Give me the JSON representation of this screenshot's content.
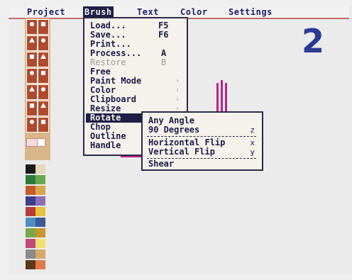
{
  "menubar": {
    "titles": [
      "Project",
      "Brush",
      "Text",
      "Color",
      "Settings"
    ],
    "active": "Brush"
  },
  "brush_menu": {
    "items": [
      {
        "label": "Load...",
        "key": "F5"
      },
      {
        "label": "Save...",
        "key": "F6"
      },
      {
        "label": "Print...",
        "key": ""
      },
      {
        "label": "Process...",
        "key": "A"
      },
      {
        "label": "Restore",
        "key": "B",
        "disabled": true
      },
      {
        "label": "Free",
        "key": ""
      },
      {
        "label": "Paint Mode",
        "key": "",
        "submenu": true
      },
      {
        "label": "Color",
        "key": "",
        "submenu": true
      },
      {
        "label": "Clipboard",
        "key": "",
        "submenu": true
      },
      {
        "label": "Resize",
        "key": "",
        "submenu": true
      },
      {
        "label": "Rotate",
        "key": "",
        "submenu": true,
        "highlighted": true
      },
      {
        "label": "Chop",
        "key": ""
      },
      {
        "label": "Outline",
        "key": ""
      },
      {
        "label": "Handle",
        "key": ""
      }
    ],
    "submenu_arrow": "›"
  },
  "rotate_submenu": {
    "items": [
      {
        "label": "Any Angle",
        "key": ""
      },
      {
        "label": "90 Degrees",
        "key": "z"
      },
      {
        "label": "Horizontal Flip",
        "key": "x"
      },
      {
        "label": "Vertical Flip",
        "key": "y"
      },
      {
        "label": "Shear",
        "key": ""
      }
    ]
  },
  "corner_number": "2",
  "colors": {
    "menu_text": "#1c1c4a",
    "highlight": "#1e1e46",
    "canvas_lines": "#b82486",
    "number": "#2a3a94",
    "toolbox": "#b04a2f"
  },
  "tool_icons": [
    "pointer-icon",
    "brush-icon",
    "circle-icon",
    "rectangle-icon",
    "line-icon",
    "fill-icon",
    "airbrush-icon",
    "curve-icon",
    "text-tool-icon",
    "grid-icon",
    "symmetry-icon",
    "magnify-icon",
    "undo-icon",
    "clear-icon"
  ],
  "palette": [
    "#1a1a1a",
    "#e8d8b8",
    "#2f7a3a",
    "#6aa84f",
    "#c25b2b",
    "#d9a64a",
    "#3d3d8a",
    "#8f6bb8",
    "#b83a3a",
    "#e8c23a",
    "#4f8fc0",
    "#3a5a9a",
    "#7aa84a",
    "#c8962f",
    "#c04a7a",
    "#f0e070",
    "#8a8a8a",
    "#d8a86a",
    "#5a3a1a",
    "#e07a4a"
  ]
}
